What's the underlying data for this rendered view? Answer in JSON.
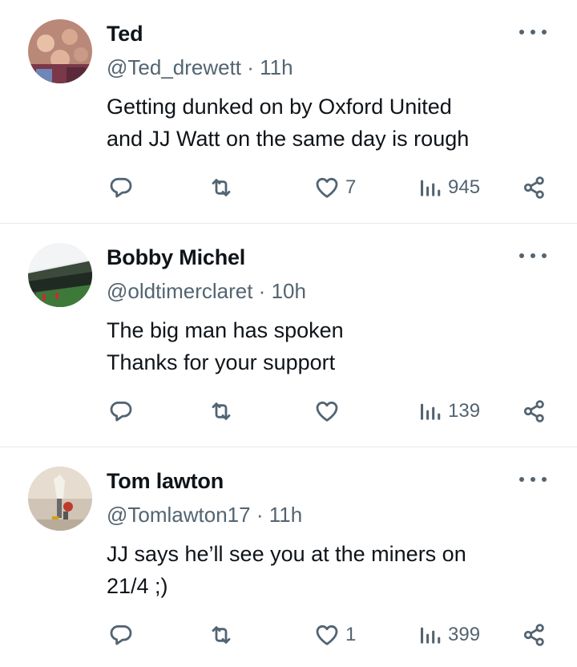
{
  "tweets": [
    {
      "name": "Ted",
      "handle": "@Ted_drewett",
      "time": "11h",
      "text_lines": [
        "Getting dunked on by Oxford United",
        "and JJ Watt on the same day is rough"
      ],
      "likes": "7",
      "views": "945"
    },
    {
      "name": "Bobby Michel",
      "handle": "@oldtimerclaret",
      "time": "10h",
      "text_lines": [
        "The big man has spoken",
        "Thanks for your support"
      ],
      "likes": "",
      "views": "139"
    },
    {
      "name": "Tom lawton",
      "handle": "@Tomlawton17",
      "time": "11h",
      "text_lines": [
        "JJ says he’ll see you at the miners on",
        "21/4 ;)"
      ],
      "likes": "1",
      "views": "399"
    }
  ],
  "separator": " · ",
  "colors": {
    "text": "#0f1419",
    "secondary": "#536471",
    "divider": "#e7e9ea"
  },
  "icons": [
    "reply-icon",
    "retweet-icon",
    "heart-icon",
    "views-icon",
    "share-icon",
    "more-icon"
  ]
}
